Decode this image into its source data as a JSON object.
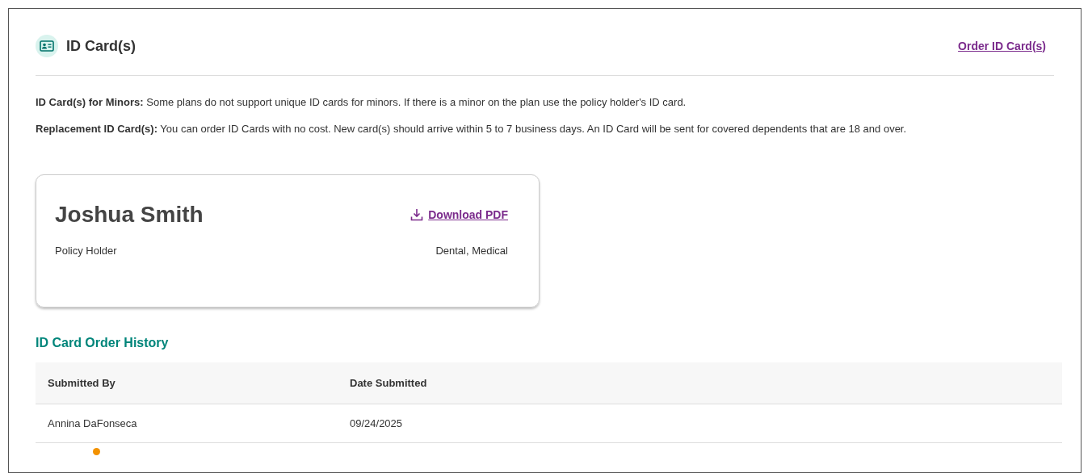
{
  "header": {
    "title": "ID Card(s)",
    "action_link": "Order ID Card(s)"
  },
  "notes": [
    {
      "label": "ID Card(s) for Minors:",
      "text": "Some plans do not support unique ID cards for minors. If there is a minor on the plan use the policy holder's ID card."
    },
    {
      "label": "Replacement ID Card(s):",
      "text": "You can order ID Cards with no cost. New card(s) should arrive within 5 to 7 business days. An ID Card will be sent for covered dependents that are 18 and over."
    }
  ],
  "cards": [
    {
      "name": "Joshua Smith",
      "download_link": "Download PDF",
      "role": "Policy Holder",
      "coverage": "Dental, Medical"
    }
  ],
  "order_history": {
    "title": "ID Card Order History",
    "columns": [
      "Submitted By",
      "Date Submitted"
    ],
    "rows": [
      [
        "Annina DaFonseca",
        "09/24/2025"
      ]
    ]
  }
}
